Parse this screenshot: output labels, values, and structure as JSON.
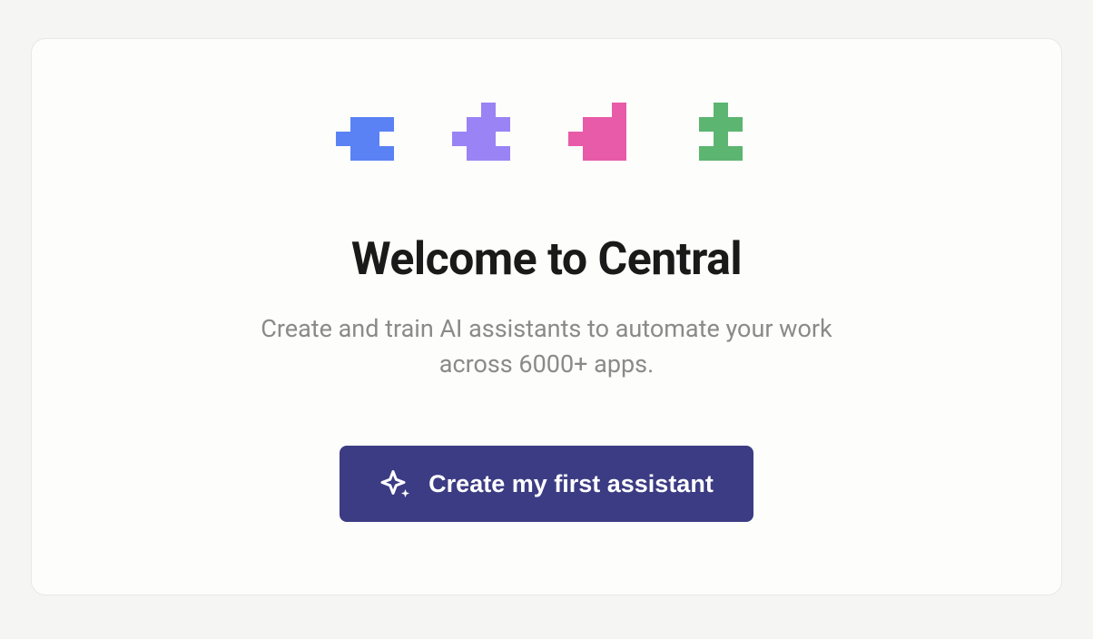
{
  "hero": {
    "heading": "Welcome to Central",
    "subtitle": "Create and train AI assistants to automate your work across 6000+ apps.",
    "cta_label": "Create my first assistant"
  },
  "puzzle_colors": {
    "blue": "#5a82f5",
    "purple": "#9a83f5",
    "pink": "#e85ba8",
    "green": "#5cb570"
  },
  "colors": {
    "cta_bg": "#3c3c84",
    "card_bg": "#fdfdfb",
    "page_bg": "#f5f5f3",
    "heading": "#1a1a1a",
    "subtitle": "#8a8a8a"
  }
}
